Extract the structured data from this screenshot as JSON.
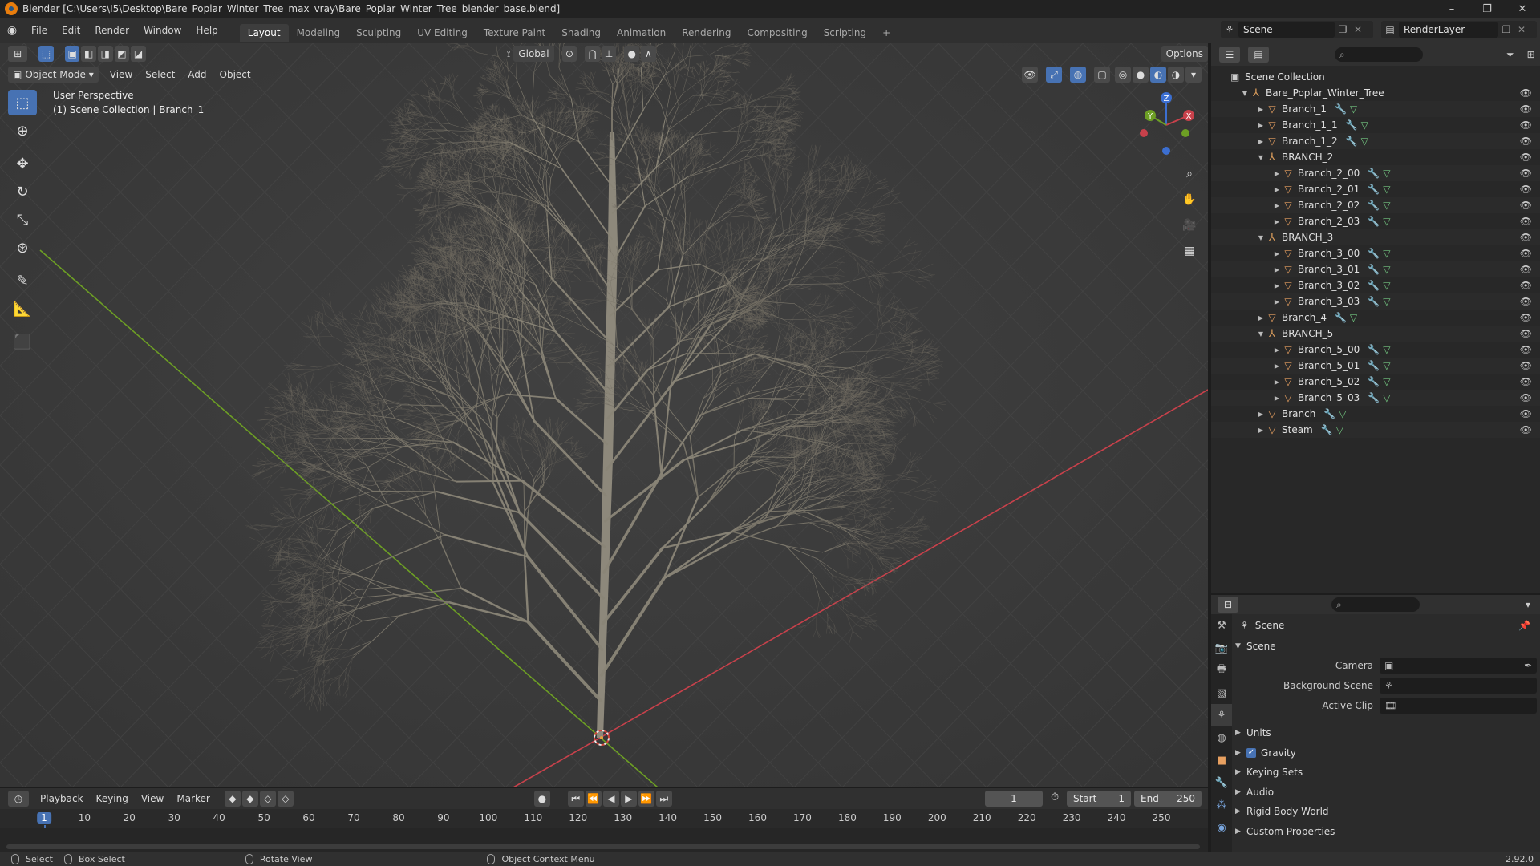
{
  "window": {
    "title": "Blender [C:\\Users\\I5\\Desktop\\Bare_Poplar_Winter_Tree_max_vray\\Bare_Poplar_Winter_Tree_blender_base.blend]",
    "minimize": "–",
    "maximize": "❐",
    "close": "✕"
  },
  "menu": [
    "File",
    "Edit",
    "Render",
    "Window",
    "Help"
  ],
  "workspaces": [
    "Layout",
    "Modeling",
    "Sculpting",
    "UV Editing",
    "Texture Paint",
    "Shading",
    "Animation",
    "Rendering",
    "Compositing",
    "Scripting"
  ],
  "workspace_active": "Layout",
  "add_workspace": "+",
  "scene_selector": {
    "scene": "Scene",
    "view_layer": "RenderLayer"
  },
  "viewport": {
    "mode": "Object Mode",
    "menus": [
      "View",
      "Select",
      "Add",
      "Object"
    ],
    "transform_orientation": "Global",
    "options_label": "Options",
    "info_line1": "User Perspective",
    "info_line2": "(1) Scene Collection | Branch_1",
    "gizmo_labels": {
      "x": "X",
      "y": "Y",
      "z": "Z"
    }
  },
  "outliner": {
    "root": "Scene Collection",
    "rows": [
      {
        "label": "Bare_Poplar_Winter_Tree",
        "depth": 1,
        "type": "empty",
        "expanded": true,
        "mods": false
      },
      {
        "label": "Branch_1",
        "depth": 2,
        "type": "mesh",
        "expanded": false,
        "mods": true
      },
      {
        "label": "Branch_1_1",
        "depth": 2,
        "type": "mesh",
        "expanded": false,
        "mods": true
      },
      {
        "label": "Branch_1_2",
        "depth": 2,
        "type": "mesh",
        "expanded": false,
        "mods": true
      },
      {
        "label": "BRANCH_2",
        "depth": 2,
        "type": "empty",
        "expanded": true,
        "mods": false
      },
      {
        "label": "Branch_2_00",
        "depth": 3,
        "type": "mesh",
        "expanded": false,
        "mods": true
      },
      {
        "label": "Branch_2_01",
        "depth": 3,
        "type": "mesh",
        "expanded": false,
        "mods": true
      },
      {
        "label": "Branch_2_02",
        "depth": 3,
        "type": "mesh",
        "expanded": false,
        "mods": true
      },
      {
        "label": "Branch_2_03",
        "depth": 3,
        "type": "mesh",
        "expanded": false,
        "mods": true
      },
      {
        "label": "BRANCH_3",
        "depth": 2,
        "type": "empty",
        "expanded": true,
        "mods": false
      },
      {
        "label": "Branch_3_00",
        "depth": 3,
        "type": "mesh",
        "expanded": false,
        "mods": true
      },
      {
        "label": "Branch_3_01",
        "depth": 3,
        "type": "mesh",
        "expanded": false,
        "mods": true
      },
      {
        "label": "Branch_3_02",
        "depth": 3,
        "type": "mesh",
        "expanded": false,
        "mods": true
      },
      {
        "label": "Branch_3_03",
        "depth": 3,
        "type": "mesh",
        "expanded": false,
        "mods": true
      },
      {
        "label": "Branch_4",
        "depth": 2,
        "type": "mesh",
        "expanded": false,
        "mods": true
      },
      {
        "label": "BRANCH_5",
        "depth": 2,
        "type": "empty",
        "expanded": true,
        "mods": false
      },
      {
        "label": "Branch_5_00",
        "depth": 3,
        "type": "mesh",
        "expanded": false,
        "mods": true
      },
      {
        "label": "Branch_5_01",
        "depth": 3,
        "type": "mesh",
        "expanded": false,
        "mods": true
      },
      {
        "label": "Branch_5_02",
        "depth": 3,
        "type": "mesh",
        "expanded": false,
        "mods": true
      },
      {
        "label": "Branch_5_03",
        "depth": 3,
        "type": "mesh",
        "expanded": false,
        "mods": true
      },
      {
        "label": "Branch",
        "depth": 2,
        "type": "mesh",
        "expanded": false,
        "mods": true
      },
      {
        "label": "Steam",
        "depth": 2,
        "type": "mesh",
        "expanded": false,
        "mods": true
      }
    ]
  },
  "properties": {
    "context": "Scene",
    "panel": "Scene",
    "camera_label": "Camera",
    "background_label": "Background Scene",
    "clip_label": "Active Clip",
    "sections": [
      "Units",
      "Gravity",
      "Keying Sets",
      "Audio",
      "Rigid Body World",
      "Custom Properties"
    ],
    "gravity_checked": true
  },
  "timeline": {
    "menus": [
      "Playback",
      "Keying",
      "View",
      "Marker"
    ],
    "current_frame": "1",
    "start_label": "Start",
    "start": "1",
    "end_label": "End",
    "end": "250",
    "ticks": [
      1,
      10,
      20,
      30,
      40,
      50,
      60,
      70,
      80,
      90,
      100,
      110,
      120,
      130,
      140,
      150,
      160,
      170,
      180,
      190,
      200,
      210,
      220,
      230,
      240,
      250
    ]
  },
  "statusbar": {
    "select": "Select",
    "box_select": "Box Select",
    "rotate": "Rotate View",
    "context_menu": "Object Context Menu",
    "version": "2.92.0"
  },
  "colors": {
    "accent": "#4772b3",
    "x_axis": "#c8414b",
    "y_axis": "#6d9f24",
    "z_axis": "#3c6fd1"
  }
}
